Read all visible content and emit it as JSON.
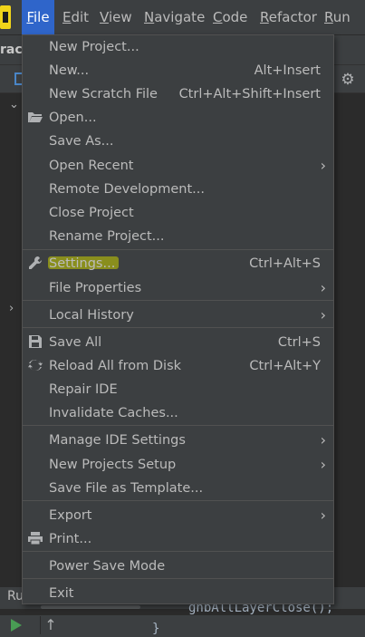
{
  "menubar": {
    "items": [
      {
        "label": "File",
        "mnemonic": "F",
        "rest": "ile"
      },
      {
        "label": "Edit",
        "mnemonic": "E",
        "rest": "dit"
      },
      {
        "label": "View",
        "mnemonic": "V",
        "rest": "iew"
      },
      {
        "label": "Navigate",
        "mnemonic": "N",
        "rest": "avigate"
      },
      {
        "label": "Code",
        "mnemonic": "C",
        "rest": "ode"
      },
      {
        "label": "Refactor",
        "mnemonic": "R",
        "rest": "efactor"
      },
      {
        "label": "Run",
        "mnemonic": "R",
        "rest": "un"
      }
    ]
  },
  "background": {
    "project_text": "rac",
    "run_tab_label": "Ru",
    "code_line": "gnbAllLayerClose();",
    "code_brace": "}"
  },
  "file_menu": {
    "items": [
      {
        "label": "New Project...",
        "shortcut": "",
        "submenu": false,
        "icon": ""
      },
      {
        "label": "New...",
        "shortcut": "Alt+Insert",
        "submenu": false,
        "icon": ""
      },
      {
        "label": "New Scratch File",
        "shortcut": "Ctrl+Alt+Shift+Insert",
        "submenu": false,
        "icon": ""
      },
      {
        "label": "Open...",
        "shortcut": "",
        "submenu": false,
        "icon": "folder-icon"
      },
      {
        "label": "Save As...",
        "shortcut": "",
        "submenu": false,
        "icon": ""
      },
      {
        "label": "Open Recent",
        "shortcut": "",
        "submenu": true,
        "icon": ""
      },
      {
        "label": "Remote Development...",
        "shortcut": "",
        "submenu": false,
        "icon": ""
      },
      {
        "label": "Close Project",
        "shortcut": "",
        "submenu": false,
        "icon": ""
      },
      {
        "label": "Rename Project...",
        "shortcut": "",
        "submenu": false,
        "icon": ""
      },
      {
        "label": "Settings...",
        "shortcut": "Ctrl+Alt+S",
        "submenu": false,
        "icon": "wrench-icon"
      },
      {
        "label": "File Properties",
        "shortcut": "",
        "submenu": true,
        "icon": ""
      },
      {
        "label": "Local History",
        "shortcut": "",
        "submenu": true,
        "icon": ""
      },
      {
        "label": "Save All",
        "shortcut": "Ctrl+S",
        "submenu": false,
        "icon": "save-icon"
      },
      {
        "label": "Reload All from Disk",
        "shortcut": "Ctrl+Alt+Y",
        "submenu": false,
        "icon": "reload-icon"
      },
      {
        "label": "Repair IDE",
        "shortcut": "",
        "submenu": false,
        "icon": ""
      },
      {
        "label": "Invalidate Caches...",
        "shortcut": "",
        "submenu": false,
        "icon": ""
      },
      {
        "label": "Manage IDE Settings",
        "shortcut": "",
        "submenu": true,
        "icon": ""
      },
      {
        "label": "New Projects Setup",
        "shortcut": "",
        "submenu": true,
        "icon": ""
      },
      {
        "label": "Save File as Template...",
        "shortcut": "",
        "submenu": false,
        "icon": ""
      },
      {
        "label": "Export",
        "shortcut": "",
        "submenu": true,
        "icon": ""
      },
      {
        "label": "Print...",
        "shortcut": "",
        "submenu": false,
        "icon": "printer-icon"
      },
      {
        "label": "Power Save Mode",
        "shortcut": "",
        "submenu": false,
        "icon": ""
      },
      {
        "label": "Exit",
        "shortcut": "",
        "submenu": false,
        "icon": ""
      }
    ],
    "submenu_arrow": "›"
  },
  "colors": {
    "menu_bg": "#3c3f41",
    "active_menu": "#2f65ca",
    "highlight": "#c8d000"
  }
}
